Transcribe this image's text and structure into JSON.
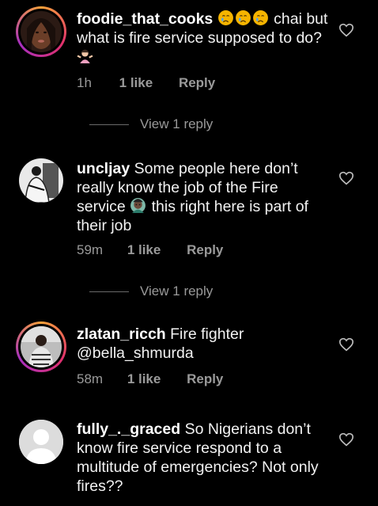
{
  "comments": [
    {
      "username": "foodie_that_cooks",
      "text_after_emojis": "chai but what is fire service supposed to do?",
      "time": "1h",
      "likes": "1 like",
      "reply": "Reply",
      "view_replies": "View 1 reply",
      "has_story_ring": true
    },
    {
      "username": "uncljay",
      "text_part1": "Some people here don’t really know the job of the Fire service",
      "text_part2": "this right here is part of their job",
      "time": "59m",
      "likes": "1 like",
      "reply": "Reply",
      "view_replies": "View 1 reply",
      "has_story_ring": false
    },
    {
      "username": "zlatan_ricch",
      "text": "Fire fighter @bella_shmurda",
      "time": "58m",
      "likes": "1 like",
      "reply": "Reply",
      "has_story_ring": true
    },
    {
      "username": "fully_._graced",
      "text": "So Nigerians don’t know fire service respond to a multitude of emergencies? Not only fires??",
      "has_story_ring": false
    }
  ],
  "colors": {
    "background": "#000000",
    "muted": "#9a9a9a",
    "story_ring_start": "#f9a23a",
    "story_ring_mid": "#e1306c"
  }
}
